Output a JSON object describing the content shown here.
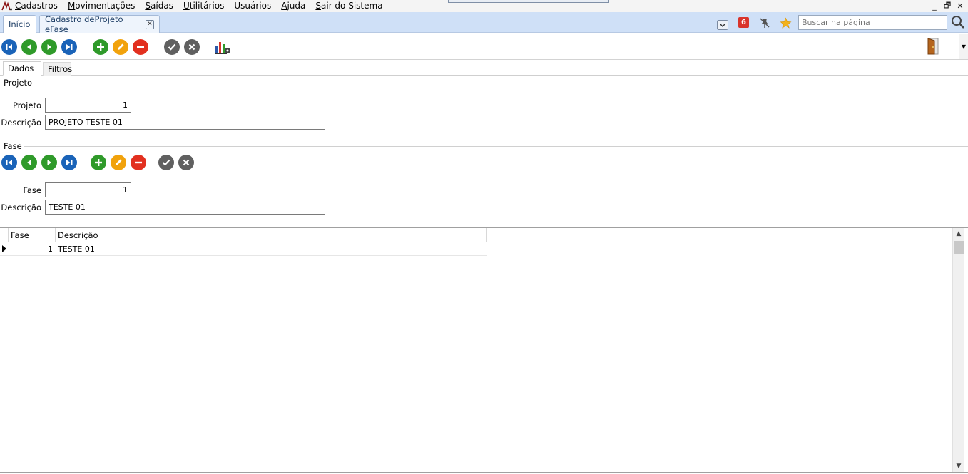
{
  "menubar": {
    "items": [
      {
        "mnemonic": "C",
        "rest": "adastros"
      },
      {
        "mnemonic": "M",
        "rest": "ovimentações"
      },
      {
        "mnemonic": "S",
        "rest": "aídas"
      },
      {
        "mnemonic": "U",
        "rest": "tilitários"
      },
      {
        "mnemonic": "",
        "rest": "Usuários"
      },
      {
        "mnemonic": "A",
        "rest": "juda"
      },
      {
        "mnemonic": "S",
        "rest": "air do Sistema"
      }
    ]
  },
  "window_controls": {
    "minimize": "_",
    "restore": "🗗",
    "close": "✕"
  },
  "tabs": {
    "home": "Início",
    "active": "Cadastro deProjeto eFase",
    "close_symbol": "✕"
  },
  "header_tools": {
    "badge_count": "6",
    "search_placeholder": "Buscar na página"
  },
  "inner_tabs": {
    "dados": "Dados",
    "filtros": "Filtros"
  },
  "projeto_group": {
    "title": "Projeto",
    "projeto_label": "Projeto",
    "projeto_value": "1",
    "descricao_label": "Descrição",
    "descricao_value": "PROJETO TESTE 01"
  },
  "fase_group": {
    "title": "Fase",
    "fase_label": "Fase",
    "fase_value": "1",
    "descricao_label": "Descrição",
    "descricao_value": "TESTE 01"
  },
  "grid": {
    "columns": [
      "Fase",
      "Descrição"
    ],
    "rows": [
      {
        "fase": "1",
        "descricao": "TESTE 01"
      }
    ]
  },
  "colors": {
    "nav_blue": "#1a63b8",
    "add_green": "#2f9a2a",
    "edit_orange": "#f1a20c",
    "delete_red": "#e2301f",
    "confirm_gray": "#606060",
    "tabbar_bg": "#cfe0f7"
  }
}
